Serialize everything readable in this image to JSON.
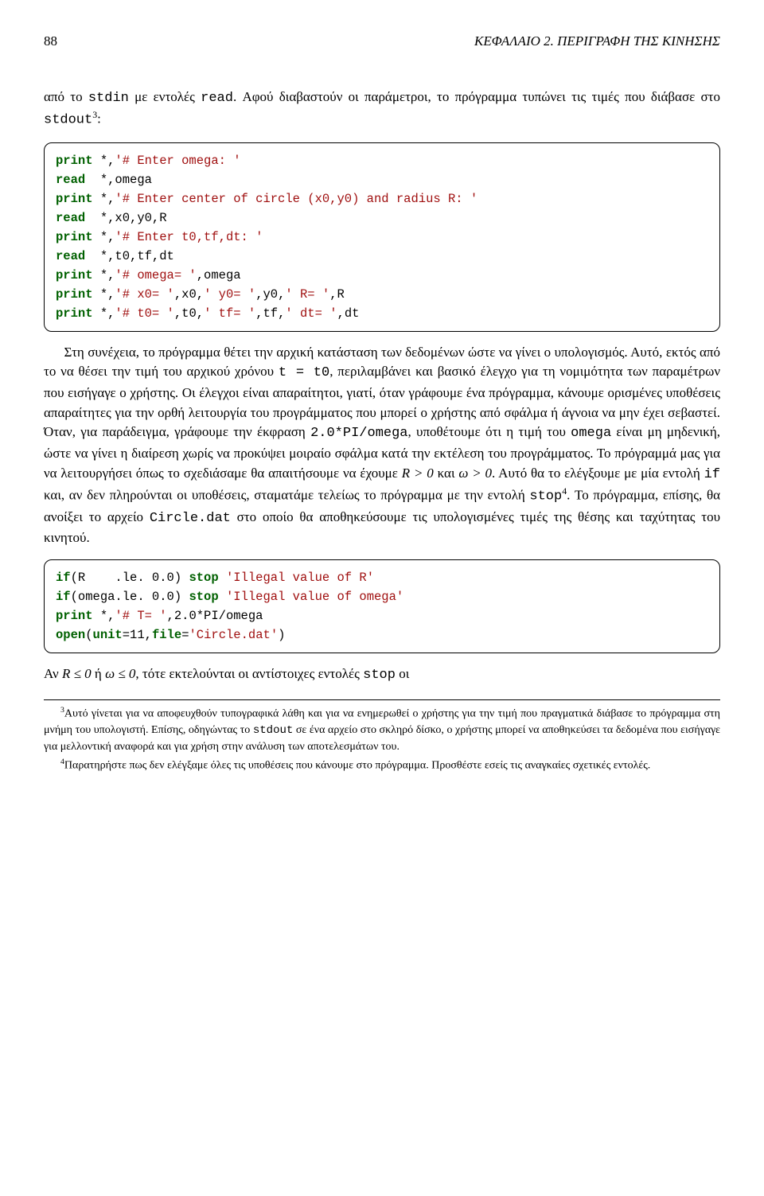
{
  "header": {
    "page_number": "88",
    "chapter": "ΚΕΦΑΛΑΙΟ 2. ΠΕΡΙΓΡΑΦΗ ΤΗΣ ΚΙΝΗΣΗΣ"
  },
  "para1_pre": "από το ",
  "para1_mono1": "stdin",
  "para1_mid": " με εντολές ",
  "para1_mono2": "read",
  "para1_post": ". Αφού διαβαστούν οι παράμετροι, το πρόγραμμα τυπώνει τις τιμές που διάβασε στο ",
  "para1_mono3": "stdout",
  "para1_sup": "3",
  "para1_end": ":",
  "code1": {
    "l1a": "print",
    "l1b": " *,",
    "l1c": "'# Enter omega: '",
    "l2a": "read",
    "l2b": "  *,omega",
    "l3a": "print",
    "l3b": " *,",
    "l3c": "'# Enter center of circle (x0,y0) and radius R: '",
    "l4a": "read",
    "l4b": "  *,x0,y0,R",
    "l5a": "print",
    "l5b": " *,",
    "l5c": "'# Enter t0,tf,dt: '",
    "l6a": "read",
    "l6b": "  *,t0,tf,dt",
    "l7a": "print",
    "l7b": " *,",
    "l7c": "'# omega= '",
    "l7d": ",omega",
    "l8a": "print",
    "l8b": " *,",
    "l8c": "'# x0= '",
    "l8d": ",x0,",
    "l8e": "' y0= '",
    "l8f": ",y0,",
    "l8g": "' R= '",
    "l8h": ",R",
    "l9a": "print",
    "l9b": " *,",
    "l9c": "'# t0= '",
    "l9d": ",t0,",
    "l9e": "' tf= '",
    "l9f": ",tf,",
    "l9g": "' dt= '",
    "l9h": ",dt"
  },
  "para2_a": "Στη συνέχεια, το πρόγραμμα θέτει την αρχική κατάσταση των δεδομένων ώστε να γίνει ο υπολογισμός. Αυτό, εκτός από το να θέσει την τιμή του αρχικού χρόνου ",
  "para2_mono1": "t = t0",
  "para2_b": ", περιλαμβάνει και βασικό έλεγχο για τη νομιμότητα των παραμέτρων που εισήγαγε ο χρήστης. Οι έλεγχοι είναι απαραίτητοι, γιατί, όταν γράφουμε ένα πρόγραμμα, κάνουμε ορισμένες υποθέσεις απαραίτητες για την ορθή λειτουργία του προγράμματος που μπορεί ο χρήστης από σφάλμα ή άγνοια να μην έχει σεβαστεί. Όταν, για παράδειγμα, γράφουμε την έκφραση ",
  "para2_mono2": "2.0*PI/omega",
  "para2_c": ", υποθέτουμε ότι η τιμή του ",
  "para2_mono3": "omega",
  "para2_d": " είναι μη μηδενική, ώστε να γίνει η διαίρεση χωρίς να προκύψει μοιραίο σφάλμα κατά την εκτέλεση του προγράμματος. Το πρόγραμμά μας για να λειτουργήσει όπως το σχεδιάσαμε θα απαιτήσουμε να έχουμε ",
  "para2_math1": "R > 0",
  "para2_e": " και ",
  "para2_math2": "ω > 0",
  "para2_f": ". Αυτό θα το ελέγξουμε με μία εντολή ",
  "para2_mono4": "if",
  "para2_g": " και, αν δεν πληρούνται οι υποθέσεις, σταματάμε τελείως το πρόγραμμα με την εντολή ",
  "para2_mono5": "stop",
  "para2_sup": "4",
  "para2_h": ". Το πρόγραμμα, επίσης, θα ανοίξει το αρχείο ",
  "para2_mono6": "Circle.dat",
  "para2_i": " στο οποίο θα αποθηκεύσουμε τις υπολογισμένες τιμές της θέσης και ταχύτητας του κινητού.",
  "code2": {
    "l1a": "if",
    "l1b": "(R    .le. 0.0) ",
    "l1c": "stop",
    "l1d": " ",
    "l1e": "'Illegal value of R'",
    "l2a": "if",
    "l2b": "(omega.le. 0.0) ",
    "l2c": "stop",
    "l2d": " ",
    "l2e": "'Illegal value of omega'",
    "l3a": "print",
    "l3b": " *,",
    "l3c": "'# T= '",
    "l3d": ",2.0*PI/omega",
    "l4a": "open",
    "l4b": "(",
    "l4c": "unit",
    "l4d": "=11,",
    "l4e": "file",
    "l4f": "=",
    "l4g": "'Circle.dat'",
    "l4h": ")"
  },
  "para3_a": "Αν ",
  "para3_m1": "R ≤ 0",
  "para3_b": " ή ",
  "para3_m2": "ω ≤ 0",
  "para3_c": ", τότε εκτελούνται οι αντίστοιχες εντολές ",
  "para3_mono1": "stop",
  "para3_d": " οι",
  "fn3_sup": "3",
  "fn3_a": "Αυτό γίνεται για να αποφευχθούν τυπογραφικά λάθη και για να ενημερωθεί ο χρήστης για την τιμή που πραγματικά διάβασε το πρόγραμμα στη μνήμη του υπολογιστή. Επίσης, οδηγώντας το ",
  "fn3_mono1": "stdout",
  "fn3_b": " σε ένα αρχείο στο σκληρό δίσκο, ο χρήστης μπορεί να αποθηκεύσει τα δεδομένα που εισήγαγε για μελλοντική αναφορά και για χρήση στην ανάλυση των αποτελεσμάτων του.",
  "fn4_sup": "4",
  "fn4_a": "Παρατηρήστε πως δεν ελέγξαμε όλες τις υποθέσεις που κάνουμε στο πρόγραμμα. Προσθέστε εσείς τις αναγκαίες σχετικές εντολές."
}
